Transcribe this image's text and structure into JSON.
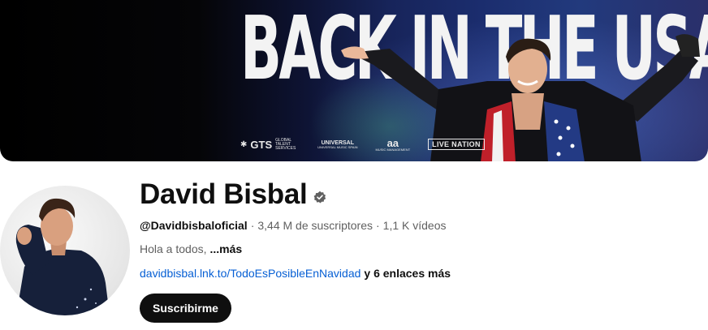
{
  "banner": {
    "title": "BACK IN THE USA",
    "logos": {
      "gts": "GTS",
      "gts_sub": "GLOBAL TALENT SERVICES",
      "universal": "UNIVERSAL",
      "universal_sub": "UNIVERSAL MUSIC SPAIN",
      "aa": "aa",
      "aa_sub": "MUSIC MANAGEMENT",
      "live_nation": "LIVE NATION"
    }
  },
  "channel": {
    "name": "David Bisbal",
    "handle": "@Davidbisbaloficial",
    "separator": "·",
    "subscribers": "3,44 M de suscriptores",
    "videos": "1,1 K vídeos",
    "description": "Hola a todos,",
    "description_more": "...más",
    "link": "davidbisbal.lnk.to/TodoEsPosibleEnNavidad",
    "more_links": "y 6 enlaces más",
    "subscribe_label": "Suscribirme"
  },
  "colors": {
    "text_primary": "#0f0f0f",
    "text_secondary": "#606060",
    "link": "#065fd4",
    "subscribe_bg": "#0f0f0f",
    "subscribe_text": "#ffffff"
  }
}
